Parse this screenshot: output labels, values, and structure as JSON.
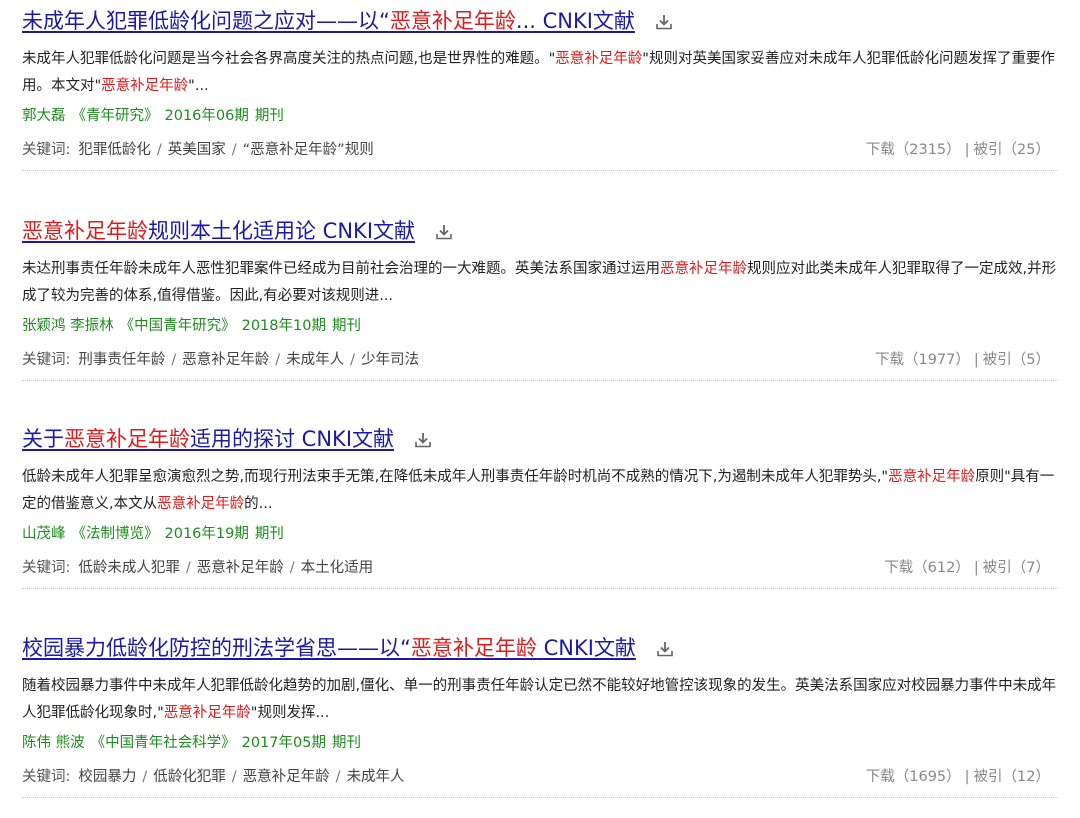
{
  "results": [
    {
      "title_pre": "未成年人犯罪低龄化问题之应对——以“",
      "title_hl": "恶意补足年龄",
      "title_post": "... CNKI文献",
      "abstract_1": "未成年人犯罪低龄化问题是当今社会各界高度关注的热点问题,也是世界性的难题。\"",
      "abstract_hl1": "恶意补足年龄",
      "abstract_2": "\"规则对英美国家妥善应对未成年人犯罪低龄化问题发挥了重要作用。本文对\"",
      "abstract_hl2": "恶意补足年龄",
      "abstract_3": "\"...",
      "authors": "郭大磊",
      "journal": "《青年研究》",
      "issue": "2016年06期",
      "type": "期刊",
      "keywords_label": "关键词:",
      "keywords": [
        "犯罪低龄化",
        "英美国家",
        "“恶意补足年龄”规则"
      ],
      "downloads": "下载（2315）",
      "citations": "被引（25）"
    },
    {
      "title_pre": "",
      "title_hl": "恶意补足年龄",
      "title_post": "规则本土化适用论 CNKI文献",
      "abstract_1": "未达刑事责任年龄未成年人恶性犯罪案件已经成为目前社会治理的一大难题。英美法系国家通过运用",
      "abstract_hl1": "恶意补足年龄",
      "abstract_2": "规则应对此类未成年人犯罪取得了一定成效,并形成了较为完善的体系,值得借鉴。因此,有必要对该规则进...",
      "abstract_hl2": "",
      "abstract_3": "",
      "authors": "张颖鸿 李振林",
      "journal": "《中国青年研究》",
      "issue": "2018年10期",
      "type": "期刊",
      "keywords_label": "关键词:",
      "keywords": [
        "刑事责任年龄",
        "恶意补足年龄",
        "未成年人",
        "少年司法"
      ],
      "downloads": "下载（1977）",
      "citations": "被引（5）"
    },
    {
      "title_pre": "关于",
      "title_hl": "恶意补足年龄",
      "title_post": "适用的探讨 CNKI文献",
      "abstract_1": "低龄未成年人犯罪呈愈演愈烈之势,而现行刑法束手无策,在降低未成年人刑事责任年龄时机尚不成熟的情况下,为遏制未成年人犯罪势头,\"",
      "abstract_hl1": "恶意补足年龄",
      "abstract_2": "原则\"具有一定的借鉴意义,本文从",
      "abstract_hl2": "恶意补足年龄",
      "abstract_3": "的...",
      "authors": "山茂峰",
      "journal": "《法制博览》",
      "issue": "2016年19期",
      "type": "期刊",
      "keywords_label": "关键词:",
      "keywords": [
        "低龄未成人犯罪",
        "恶意补足年龄",
        "本土化适用"
      ],
      "downloads": "下载（612）",
      "citations": "被引（7）"
    },
    {
      "title_pre": "校园暴力低龄化防控的刑法学省思——以“",
      "title_hl": "恶意补足年龄",
      "title_post": " CNKI文献",
      "abstract_1": "随着校园暴力事件中未成年人犯罪低龄化趋势的加剧,僵化、单一的刑事责任年龄认定已然不能较好地管控该现象的发生。英美法系国家应对校园暴力事件中未成年人犯罪低龄化现象时,\"",
      "abstract_hl1": "恶意补足年龄",
      "abstract_2": "\"规则发挥...",
      "abstract_hl2": "",
      "abstract_3": "",
      "authors": "陈伟 熊波",
      "journal": "《中国青年社会科学》",
      "issue": "2017年05期",
      "type": "期刊",
      "keywords_label": "关键词:",
      "keywords": [
        "校园暴力",
        "低龄化犯罪",
        "恶意补足年龄",
        "未成年人"
      ],
      "downloads": "下载（1695）",
      "citations": "被引（12）"
    }
  ],
  "colors": {
    "title": "#1a1aa6",
    "highlight": "#e01b1b",
    "meta": "#1f8c1f",
    "stats": "#888888"
  }
}
